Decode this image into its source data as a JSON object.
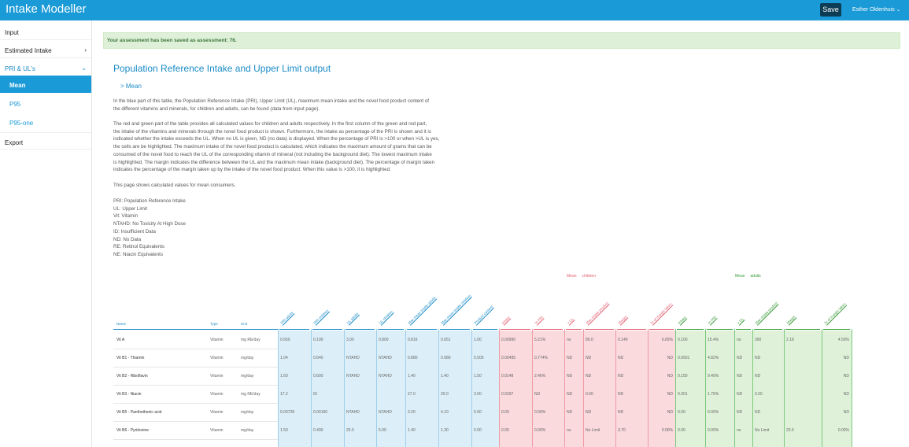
{
  "app": {
    "title": "Intake Modeller",
    "save_label": "Save",
    "user_name": "Esther Oldenhuis",
    "user_chevron": "⌄"
  },
  "sidebar": {
    "items": [
      {
        "label": "Input",
        "chevron": ""
      },
      {
        "label": "Estimated Intake",
        "chevron": "›"
      },
      {
        "label": "PRI & UL's",
        "chevron": "⌄"
      },
      {
        "label": "Mean"
      },
      {
        "label": "P95"
      },
      {
        "label": "P95-one"
      },
      {
        "label": "Export",
        "chevron": ""
      }
    ]
  },
  "alert": {
    "text": "Your assessment has been saved as assessment: 76."
  },
  "main": {
    "title": "Population Reference Intake and Upper Limit output",
    "breadcrumb": "> Mean",
    "paragraph1_lines": [
      "In the blue part of this table, the Population Reference Intake (PRI), Upper Limit (UL), maximum mean intake and the novel food product content of",
      "the different vitamins and minerals, for children and adults, can be found (data from input page)."
    ],
    "paragraph2_lines": [
      "The red and green part of the table provides all calculated values for children and adults respectively. In the first column of the green and red part,",
      "the intake of the vitamins and minerals through the novel food product is shown. Furthermore, the intake as percentage of the PRI is shown and it is",
      "indicated whether the intake exceeds the UL. When no UL is given, ND (no data) is displayed. When the percentage of PRI is >100 or when >UL is yes,",
      "the cells are be highlighted. The maximum intake of the novel food product is calculated, which indicates the maximum amount of grams that can be",
      "consumed of the novel food to reach the UL of the corresponding vitamin of mineral (not including the background diet). The lowest maximum intake",
      "is highlighted. The margin indicates the difference between the UL and the maximum mean intake (background diet). The percentage of margin taken",
      "indicates the percentage of the margin taken up by the intake of the novel food product. When this value is >100, it is highlighted."
    ],
    "paragraph3": "This page shows calculated values for mean consumers.",
    "abbreviations": [
      "PRI: Population Reference Intake",
      "UL: Upper Limit",
      "Vit: Vitamin",
      "NTAHD: No Toxicity At High Dose",
      "ID: Insufficient Data",
      "ND: No Data",
      "RE: Retinol Equivalents",
      "NE: Niacin Equivalents"
    ]
  },
  "table": {
    "legend_children": {
      "prefix": "Mean",
      "label": "children"
    },
    "legend_adults": {
      "prefix": "Mean",
      "label": "adults"
    },
    "col_name": "Name",
    "col_type": "Type",
    "col_unit": "Unit",
    "blue_headers": [
      "PRI adults",
      "PRI children",
      "UL adults",
      "UL children",
      "Max mean intake adults",
      "Max mean intake children",
      "Product content"
    ],
    "red_headers": [
      "Intake",
      "% PRI",
      "> UL",
      "Max intake product",
      "Margin",
      "% of margin taken"
    ],
    "green_headers": [
      "Intake",
      "% PRI",
      "> UL",
      "Max intake product",
      "Margin",
      "% of margin taken"
    ],
    "rows": [
      {
        "name": "Vit A",
        "type": "Vitamin",
        "unit": "mg RE/day",
        "blue": [
          "0.650",
          "0.190",
          "3.00",
          "0.800",
          "0.816",
          "0.651",
          "1.00"
        ],
        "red": [
          "0.00990",
          "5.21%",
          "no",
          "80.0",
          "0.149",
          "6.65%"
        ],
        "green": [
          "0.100",
          "15.4%",
          "no",
          "300",
          "2.18",
          "4.59%"
        ]
      },
      {
        "name": "Vit B1 - Thiamin",
        "type": "Vitamin",
        "unit": "mg/day",
        "blue": [
          "1.04",
          "0.640",
          "NTAHD",
          "NTAHD",
          "0.880",
          "0.980",
          "0.500"
        ],
        "red": [
          "0.00495",
          "0.774%",
          "ND",
          "ND",
          "ND",
          "ND"
        ],
        "green": [
          "0.0501",
          "4.82%",
          "ND",
          "ND",
          "",
          "ND"
        ]
      },
      {
        "name": "Vit B2 - Riboflavin",
        "type": "Vitamin",
        "unit": "mg/day",
        "blue": [
          "1.60",
          "0.600",
          "NTAHD",
          "NTAHD",
          "1.40",
          "1.40",
          "1.50"
        ],
        "red": [
          "0.0148",
          "2.46%",
          "ND",
          "ND",
          "ND",
          "ND"
        ],
        "green": [
          "0.150",
          "9.40%",
          "ND",
          "ND",
          "",
          "ND"
        ]
      },
      {
        "name": "Vit B3 - Niacin",
        "type": "Vitamin",
        "unit": "mg NE/day",
        "blue": [
          "17.2",
          "ID",
          "",
          "",
          "27.0",
          "20.0",
          "3.00"
        ],
        "red": [
          "0.0297",
          "ND",
          "ND",
          "0.00",
          "ND",
          "ND"
        ],
        "green": [
          "0.301",
          "1.75%",
          "ND",
          "0.00",
          "",
          "ND"
        ]
      },
      {
        "name": "Vit B5 - Panthothenic acid",
        "type": "Vitamin",
        "unit": "mg/day",
        "blue": [
          "0.00728",
          "0.00160",
          "NTAHD",
          "NTAHD",
          "3.20",
          "4.10",
          "0.00"
        ],
        "red": [
          "0.00",
          "0.00%",
          "ND",
          "ND",
          "ND",
          "ND"
        ],
        "green": [
          "0.00",
          "0.00%",
          "ND",
          "ND",
          "",
          "ND"
        ]
      },
      {
        "name": "Vit B6 - Pyridoxine",
        "type": "Vitamin",
        "unit": "mg/day",
        "blue": [
          "1.50",
          "0.400",
          "25.0",
          "5.00",
          "1.40",
          "1.30",
          "0.00"
        ],
        "red": [
          "0.00",
          "0.00%",
          "no",
          "No Limit",
          "3.70",
          "0.00%"
        ],
        "green": [
          "0.00",
          "0.00%",
          "no",
          "No Limit",
          "23.6",
          "0.00%"
        ]
      }
    ]
  },
  "colors": {
    "primary": "#1a9ad6",
    "blue_bg": "#dceff8",
    "red_bg": "#fadadd",
    "green_bg": "#dff2d9",
    "alert_bg": "#dff0d8"
  }
}
